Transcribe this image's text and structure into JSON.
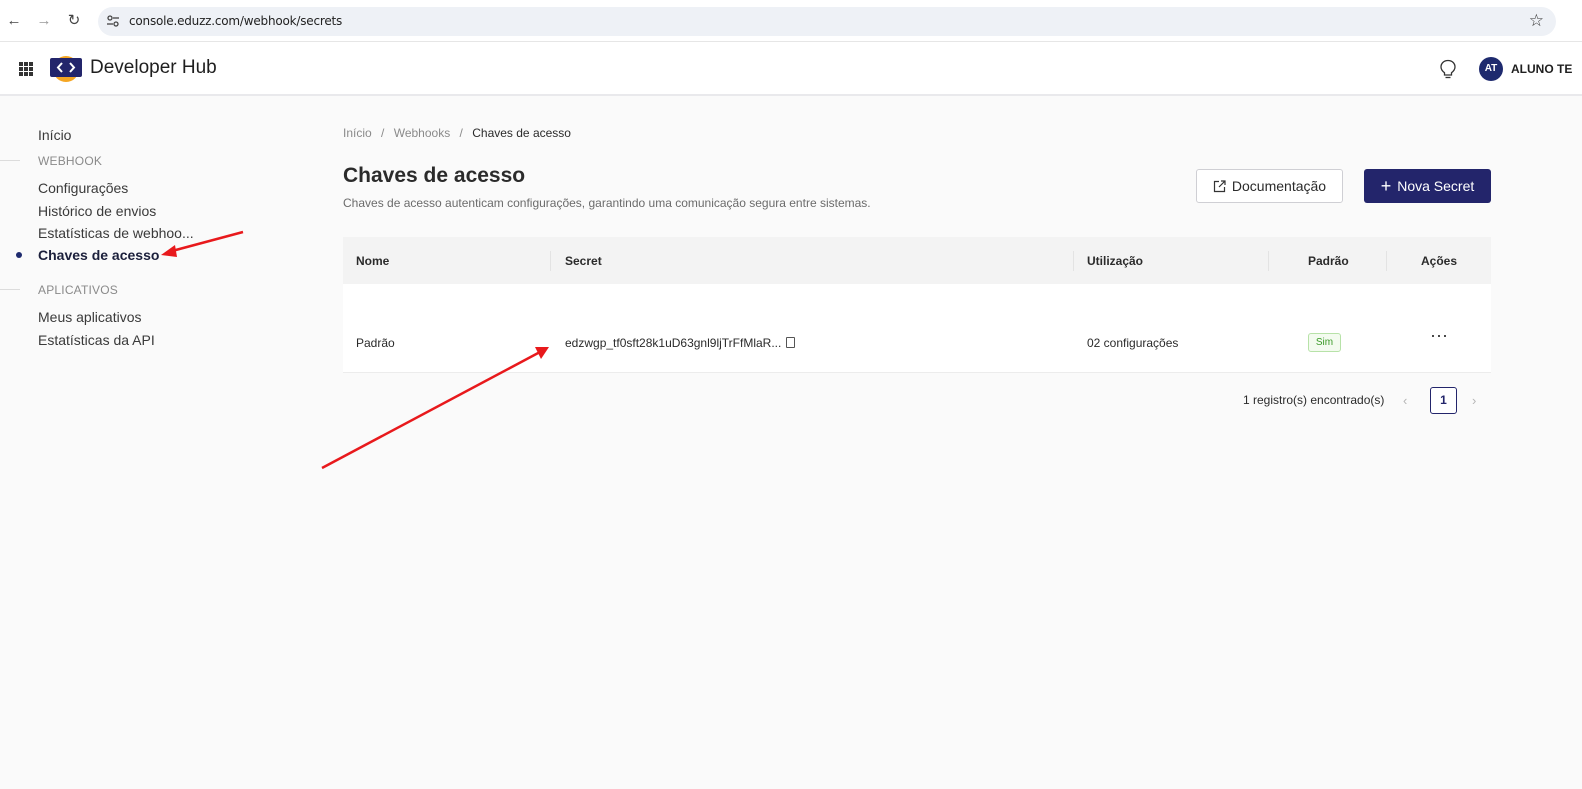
{
  "browser": {
    "url": "console.eduzz.com/webhook/secrets"
  },
  "header": {
    "brand": "Developer Hub",
    "avatar_initials": "AT",
    "user_name": "ALUNO TE"
  },
  "sidebar": {
    "home": "Início",
    "section_webhook": "WEBHOOK",
    "webhook_items": [
      "Configurações",
      "Histórico de envios",
      "Estatísticas de webhoo...",
      "Chaves de acesso"
    ],
    "section_apps": "APLICATIVOS",
    "app_items": [
      "Meus aplicativos",
      "Estatísticas da API"
    ],
    "active_item": "Chaves de acesso"
  },
  "breadcrumb": {
    "items": [
      "Início",
      "Webhooks",
      "Chaves de acesso"
    ],
    "separator": "/"
  },
  "page": {
    "title": "Chaves de acesso",
    "subtitle": "Chaves de acesso autenticam configurações, garantindo uma comunicação segura entre sistemas.",
    "doc_button": "Documentação",
    "new_button": "Nova Secret"
  },
  "table": {
    "columns": [
      "Nome",
      "Secret",
      "Utilização",
      "Padrão",
      "Ações"
    ],
    "rows": [
      {
        "name": "Padrão",
        "secret": "edzwgp_tf0sft28k1uD63gnl9ljTrFfMlaR...",
        "usage": "02 configurações",
        "default": "Sim",
        "actions": "···"
      }
    ]
  },
  "pagination": {
    "records": "1 registro(s) encontrado(s)",
    "current_page": "1",
    "prev": "‹",
    "next": "›"
  },
  "colors": {
    "primary": "#23256b",
    "annotation_arrow": "#e8191c",
    "badge_green": "#3a9a27"
  },
  "icons": [
    "back-arrow-icon",
    "forward-arrow-icon",
    "reload-icon",
    "site-info-icon",
    "star-icon",
    "apps-grid-icon",
    "developer-hub-logo",
    "lightbulb-icon",
    "external-link-icon",
    "plus-icon",
    "copy-icon",
    "ellipsis-icon"
  ]
}
